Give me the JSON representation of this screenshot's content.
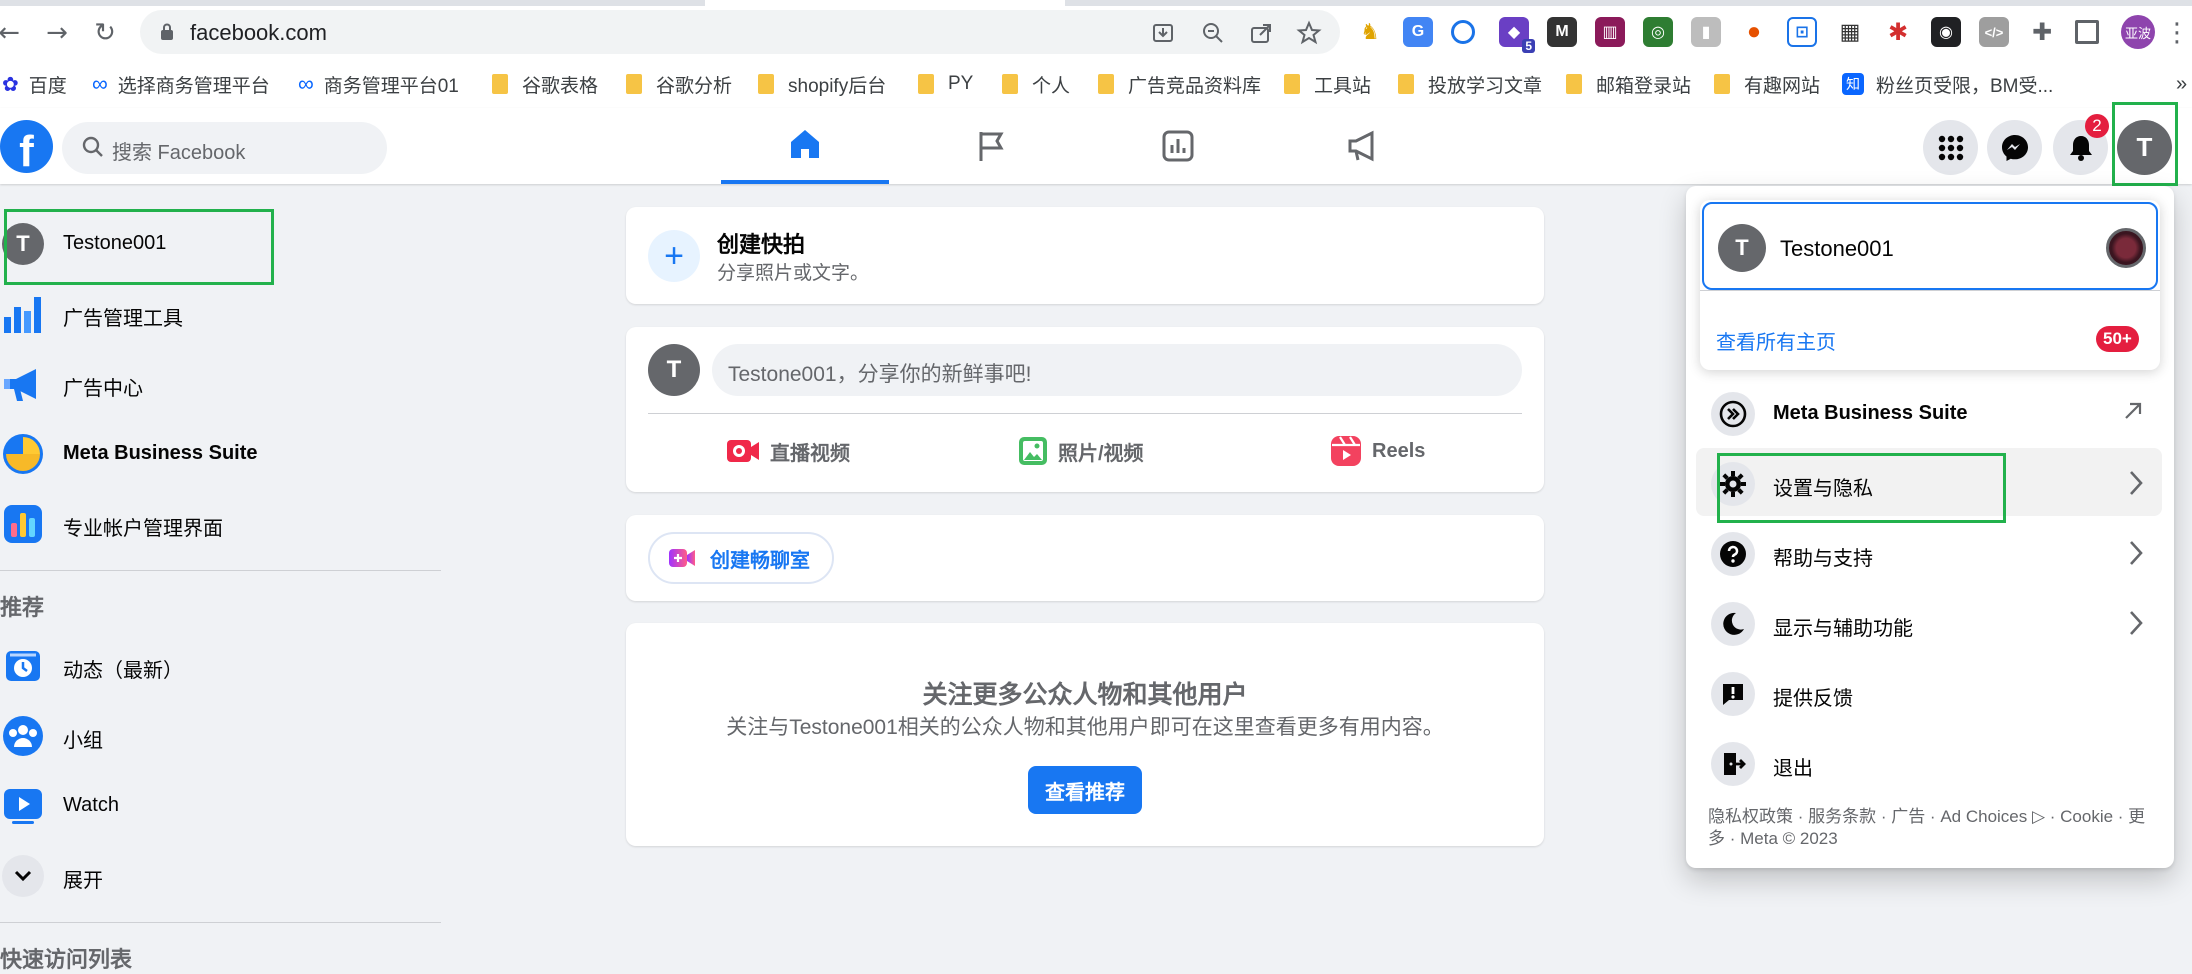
{
  "browser": {
    "url": "facebook.com",
    "profile_label": "亚波",
    "extension_badge": "5",
    "bookmarks": [
      {
        "label": "百度",
        "icon": "paw-icon"
      },
      {
        "label": "选择商务管理平台",
        "icon": "meta-icon"
      },
      {
        "label": "商务管理平台01",
        "icon": "meta-icon"
      },
      {
        "label": "谷歌表格",
        "icon": "folder-icon"
      },
      {
        "label": "谷歌分析",
        "icon": "folder-icon"
      },
      {
        "label": "shopify后台",
        "icon": "folder-icon"
      },
      {
        "label": "PY",
        "icon": "folder-icon"
      },
      {
        "label": "个人",
        "icon": "folder-icon"
      },
      {
        "label": "广告竞品资料库",
        "icon": "folder-icon"
      },
      {
        "label": "工具站",
        "icon": "folder-icon"
      },
      {
        "label": "投放学习文章",
        "icon": "folder-icon"
      },
      {
        "label": "邮箱登录站",
        "icon": "folder-icon"
      },
      {
        "label": "有趣网站",
        "icon": "folder-icon"
      },
      {
        "label": "粉丝页受限，BM受...",
        "icon": "zhihu-icon"
      }
    ],
    "bookmarks_more": "»"
  },
  "header": {
    "search_placeholder": "搜索 Facebook",
    "notifications_count": "2",
    "avatar_letter": "T"
  },
  "sidebar": {
    "profile": {
      "letter": "T",
      "name": "Testone001"
    },
    "items": [
      {
        "label": "广告管理工具"
      },
      {
        "label": "广告中心"
      },
      {
        "label": "Meta Business Suite"
      },
      {
        "label": "专业帐户管理界面"
      }
    ],
    "recommend_heading": "推荐",
    "rec_items": [
      {
        "label": "动态（最新）"
      },
      {
        "label": "小组"
      },
      {
        "label": "Watch"
      },
      {
        "label": "展开"
      }
    ],
    "shortcuts_heading": "快速访问列表"
  },
  "main": {
    "story": {
      "title": "创建快拍",
      "subtitle": "分享照片或文字。",
      "plus": "+"
    },
    "composer": {
      "letter": "T",
      "placeholder": "Testone001，分享你的新鲜事吧!",
      "actions": [
        {
          "label": "直播视频",
          "color": "#f02849"
        },
        {
          "label": "照片/视频",
          "color": "#45bd62"
        },
        {
          "label": "Reels",
          "color": "#f3425f"
        }
      ]
    },
    "room": {
      "label": "创建畅聊室"
    },
    "follow": {
      "title": "关注更多公众人物和其他用户",
      "desc": "关注与Testone001相关的公众人物和其他用户即可在这里查看更多有用内容。",
      "button": "查看推荐"
    }
  },
  "menu": {
    "profile": {
      "letter": "T",
      "name": "Testone001"
    },
    "see_all": "查看所有主页",
    "see_all_badge": "50+",
    "items": [
      {
        "label": "Meta Business Suite"
      },
      {
        "label": "设置与隐私"
      },
      {
        "label": "帮助与支持"
      },
      {
        "label": "显示与辅助功能"
      },
      {
        "label": "提供反馈"
      },
      {
        "label": "退出"
      }
    ],
    "footer_line1": "隐私权政策 · 服务条款 · 广告 · Ad Choices ▷ · Cookie · 更",
    "footer_line2": "多 · Meta © 2023"
  },
  "colors": {
    "brand": "#1877f2",
    "highlight": "#22b14c"
  }
}
